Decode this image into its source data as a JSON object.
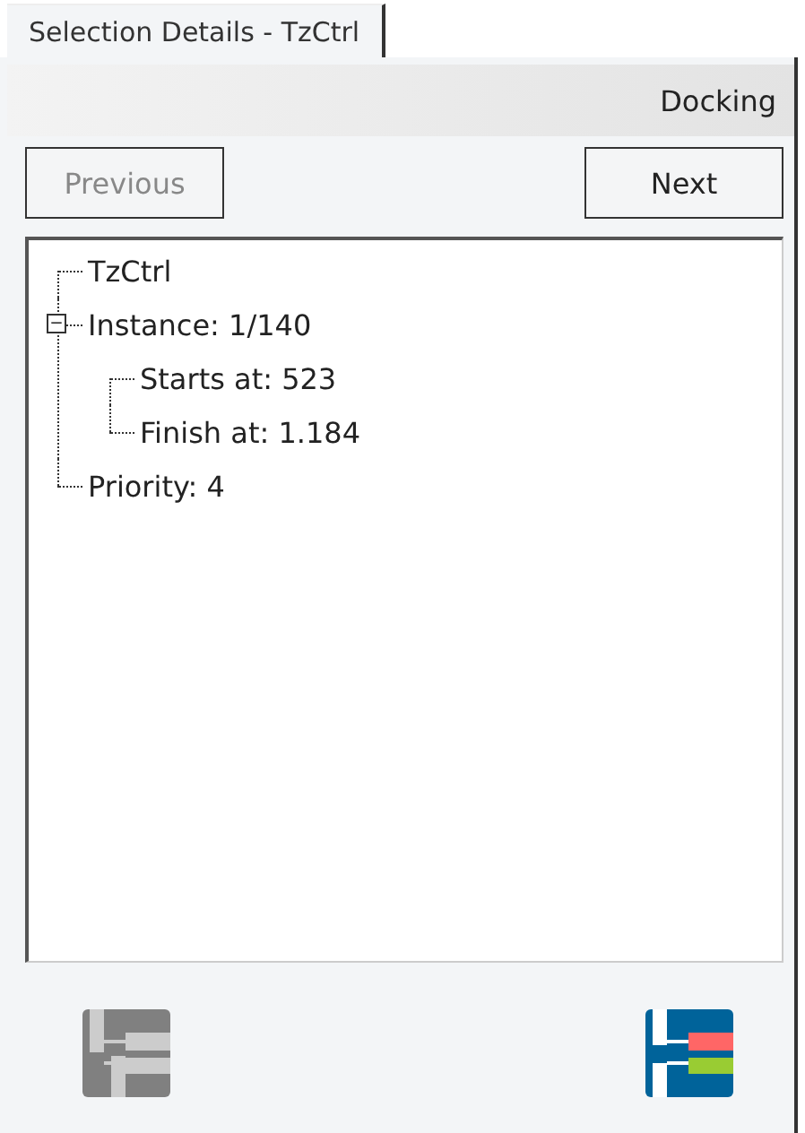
{
  "tab": {
    "label": "Selection Details - TzCtrl",
    "selected": true
  },
  "docking_bar": {
    "label": "Docking"
  },
  "buttons": [
    {
      "label": "Previous",
      "disabled": true
    },
    {
      "label": "Next",
      "disabled": false
    }
  ],
  "tree": [
    {
      "label": "TzCtrl"
    },
    {
      "label": "Instance: 1/140",
      "expanded": true,
      "children": [
        {
          "label": "Starts at: 523"
        },
        {
          "label": "Finish at: 1.184"
        }
      ]
    },
    {
      "label": "Priority: 4"
    }
  ],
  "toolbar": [
    {
      "kind": "tree",
      "disabled": true
    },
    {
      "kind": "tree",
      "disabled": false
    }
  ]
}
